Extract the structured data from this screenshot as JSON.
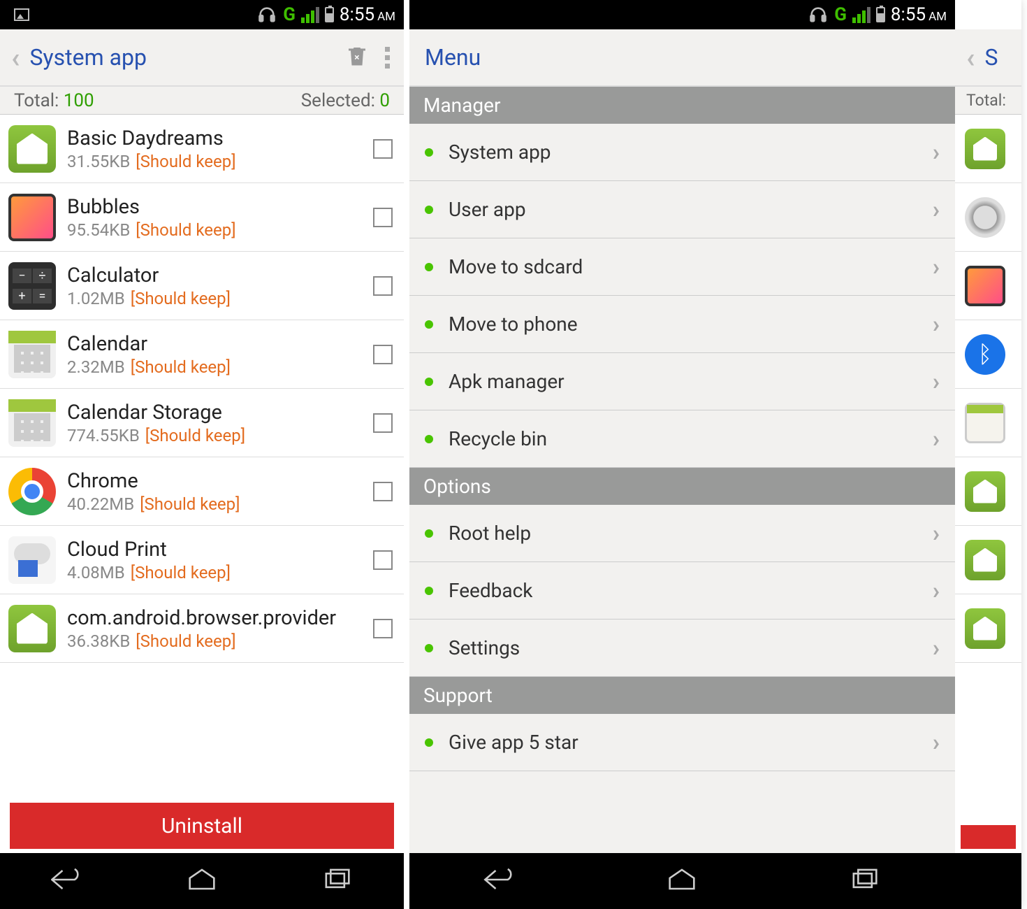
{
  "status": {
    "time": "8:55",
    "ampm": "AM",
    "net": "G"
  },
  "left": {
    "title": "System app",
    "totalLabel": "Total:",
    "totalValue": "100",
    "selectedLabel": "Selected:",
    "selectedValue": "0",
    "uninstall": "Uninstall",
    "apps": [
      {
        "name": "Basic Daydreams",
        "size": "31.55KB",
        "keep": "[Should keep]",
        "icon": "android"
      },
      {
        "name": "Bubbles",
        "size": "95.54KB",
        "keep": "[Should keep]",
        "icon": "bubbles"
      },
      {
        "name": "Calculator",
        "size": "1.02MB",
        "keep": "[Should keep]",
        "icon": "calc"
      },
      {
        "name": "Calendar",
        "size": "2.32MB",
        "keep": "[Should keep]",
        "icon": "cal"
      },
      {
        "name": "Calendar Storage",
        "size": "774.55KB",
        "keep": "[Should keep]",
        "icon": "cal"
      },
      {
        "name": "Chrome",
        "size": "40.22MB",
        "keep": "[Should keep]",
        "icon": "chrome"
      },
      {
        "name": "Cloud Print",
        "size": "4.08MB",
        "keep": "[Should keep]",
        "icon": "cloud"
      },
      {
        "name": "com.android.browser.provider",
        "size": "36.38KB",
        "keep": "[Should keep]",
        "icon": "android"
      }
    ]
  },
  "menu": {
    "title": "Menu",
    "sections": [
      {
        "header": "Manager",
        "items": [
          "System app",
          "User app",
          "Move to sdcard",
          "Move to phone",
          "Apk manager",
          "Recycle bin"
        ]
      },
      {
        "header": "Options",
        "items": [
          "Root help",
          "Feedback",
          "Settings"
        ]
      },
      {
        "header": "Support",
        "items": [
          "Give app 5 star"
        ]
      }
    ]
  },
  "peek": {
    "titleChar": "S",
    "totalLabel": "Total:",
    "icons": [
      "android",
      "gear",
      "bubbles",
      "bt",
      "pkg",
      "android",
      "android",
      "android"
    ]
  }
}
